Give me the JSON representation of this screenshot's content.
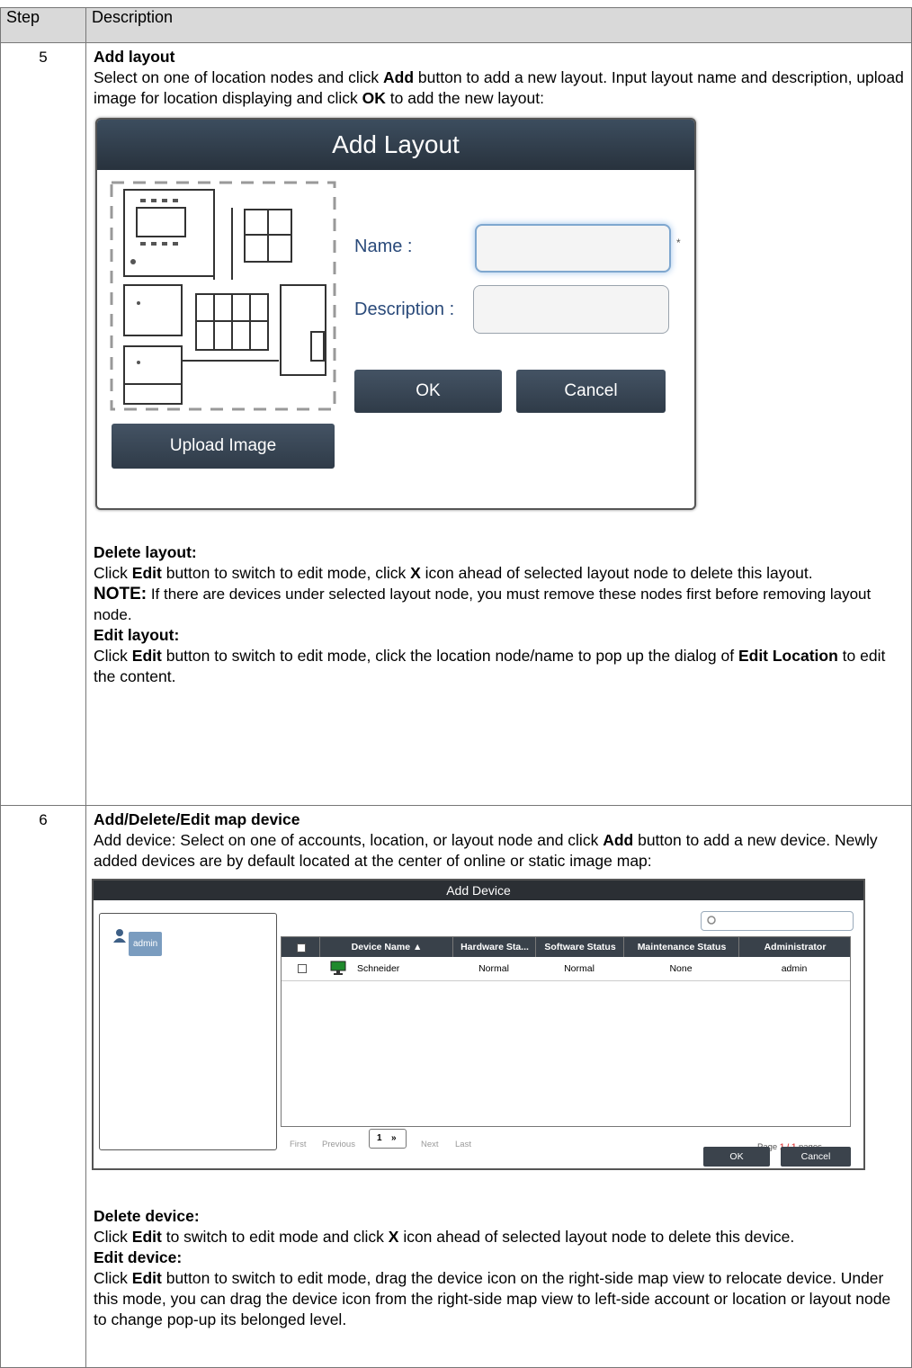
{
  "table": {
    "header_step": "Step",
    "header_description": "Description"
  },
  "row5": {
    "step": "5",
    "title": "Add layout",
    "p1_a": "Select on one of location nodes and click ",
    "p1_b": "Add",
    "p1_c": " button to add a new layout. Input layout name and description, upload image for location displaying and click ",
    "p1_d": "OK",
    "p1_e": " to add the new layout:",
    "dialog": {
      "title": "Add Layout",
      "name_label": "Name :",
      "description_label": "Description :",
      "required_mark": "*",
      "ok": "OK",
      "cancel": "Cancel",
      "upload": "Upload Image"
    },
    "delete_title": "Delete layout:",
    "delete_a": "Click ",
    "delete_b": "Edit",
    "delete_c": " button to switch to edit mode, click ",
    "delete_d": "X",
    "delete_e": " icon ahead of selected layout node to delete this layout.",
    "note_label": "NOTE:",
    "note_text": " If there are devices under selected layout node, you must remove these nodes first before removing layout node.",
    "edit_title": "Edit layout:",
    "edit_a": "Click ",
    "edit_b": "Edit",
    "edit_c": " button to switch to edit mode, click the location node/name to pop up the dialog of ",
    "edit_d": "Edit Location",
    "edit_e": " to edit the content."
  },
  "row6": {
    "step": "6",
    "title": "Add/Delete/Edit map device",
    "p1_a": "Add device: Select on one of accounts, location, or layout node and click ",
    "p1_b": "Add",
    "p1_c": " button to add a new device. Newly added devices are by default located at the center of online or static image map:",
    "dialog": {
      "title": "Add Device",
      "tree_user": "admin",
      "columns": [
        "Device Name ▲",
        "Hardware Sta...",
        "Software Status",
        "Maintenance Status",
        "Administrator"
      ],
      "rows": [
        {
          "device_name": "Schneider",
          "hardware": "Normal",
          "software": "Normal",
          "maintenance": "None",
          "administrator": "admin"
        }
      ],
      "pager": {
        "first": "First",
        "previous": "Previous",
        "page_value": "1",
        "next": "Next",
        "last": "Last",
        "page_prefix": "Page ",
        "page_current": "1 / 1",
        "page_suffix": " pages"
      },
      "ok": "OK",
      "cancel": "Cancel"
    },
    "delete_title": "Delete device:",
    "delete_a": "Click ",
    "delete_b": "Edit",
    "delete_c": " to switch to edit mode and click ",
    "delete_d": "X",
    "delete_e": " icon ahead of selected layout node to delete this device.",
    "edit_title": "Edit device:",
    "edit_a": "Click ",
    "edit_b": "Edit",
    "edit_c": " button to switch to edit mode, drag the device icon on the right-side map view to relocate device. Under this mode, you can drag the device icon from the right-side map view to left-side account or location or layout node to change pop-up its belonged level."
  }
}
